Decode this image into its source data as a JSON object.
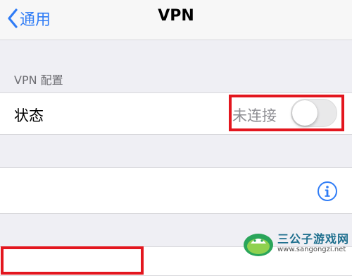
{
  "navbar": {
    "back_label": "通用",
    "title": "VPN"
  },
  "vpn_config": {
    "section_header": "VPN 配置",
    "status_label": "状态",
    "status_value": "未连接",
    "toggle_on": false
  },
  "watermark": {
    "title": "三公子游戏网",
    "url": "www.sangongzi.net"
  },
  "colors": {
    "accent": "#2f7cf6",
    "highlight": "#e3161e"
  }
}
